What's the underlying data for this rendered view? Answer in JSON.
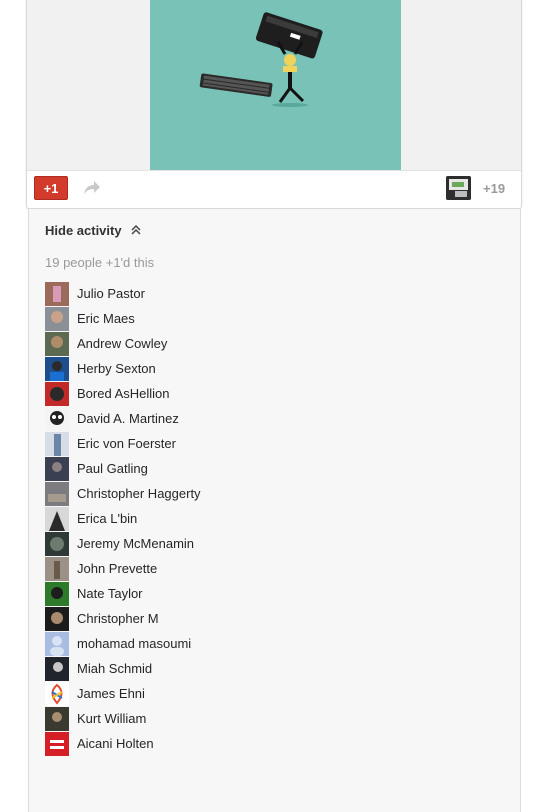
{
  "post": {
    "plusone_label": "+1",
    "plus_count": "+19",
    "image_icon": "keyboard-smash-illustration",
    "accent_color": "#d23a2c"
  },
  "activity": {
    "hide_label": "Hide activity",
    "chevron_icon": "chevron-double-up-icon",
    "people_count_text": "19 people +1'd this",
    "people": [
      {
        "name": "Julio Pastor",
        "avatar_color": "#9b6a5a"
      },
      {
        "name": "Eric Maes",
        "avatar_color": "#8b8f96"
      },
      {
        "name": "Andrew Cowley",
        "avatar_color": "#5d6a52"
      },
      {
        "name": "Herby Sexton",
        "avatar_color": "#1f4e8c"
      },
      {
        "name": "Bored AsHellion",
        "avatar_color": "#c22a2a"
      },
      {
        "name": "David A. Martinez",
        "avatar_color": "#222222"
      },
      {
        "name": "Eric von Foerster",
        "avatar_color": "#6b87a8"
      },
      {
        "name": "Paul Gatling",
        "avatar_color": "#3a3f52"
      },
      {
        "name": "Christopher Haggerty",
        "avatar_color": "#7c7c80"
      },
      {
        "name": "Erica L'bin",
        "avatar_color": "#d8d8d8"
      },
      {
        "name": "Jeremy McMenamin",
        "avatar_color": "#2f3a36"
      },
      {
        "name": "John Prevette",
        "avatar_color": "#6a5a4a"
      },
      {
        "name": "Nate Taylor",
        "avatar_color": "#2c7a2a"
      },
      {
        "name": "Christopher M",
        "avatar_color": "#1c1c1c"
      },
      {
        "name": "mohamad masoumi",
        "avatar_color": "#a8bde0"
      },
      {
        "name": "Miah Schmid",
        "avatar_color": "#20242c"
      },
      {
        "name": "James Ehni",
        "avatar_color": "#e8e2d0"
      },
      {
        "name": "Kurt William",
        "avatar_color": "#3a3a30"
      },
      {
        "name": "Aicani Holten",
        "avatar_color": "#d41f26"
      }
    ]
  }
}
